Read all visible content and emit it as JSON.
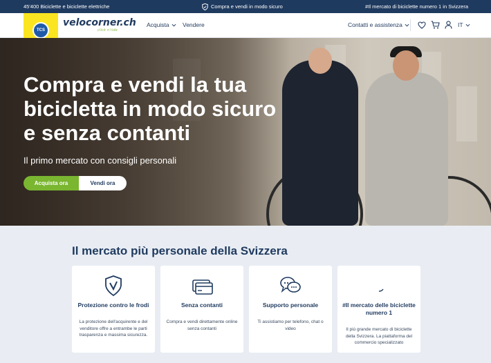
{
  "topbar": {
    "left": "45'400 Biciclette e biciclette elettriche",
    "center": "Compra e vendi in modo sicuro",
    "right": "#Il mercato di biciclette numero 1 in Svizzera"
  },
  "nav": {
    "logo_badge": "TCS",
    "brand": "velocorner.ch",
    "tagline": "click n'ride",
    "links": {
      "buy": "Acquista",
      "sell": "Vendere"
    },
    "contact": "Contatti e assistenza",
    "language": "IT",
    "icons": [
      "heart-icon",
      "cart-icon",
      "user-icon"
    ]
  },
  "hero": {
    "headline": "Compra e vendi la tua bicicletta in modo sicuro e senza contanti",
    "subline": "Il primo mercato con consigli personali",
    "buy_button": "Acquista ora",
    "sell_button": "Vendi ora"
  },
  "features": {
    "title": "Il mercato più personale della Svizzera",
    "cards": [
      {
        "icon": "shield-check-icon",
        "title": "Protezione contro le frodi",
        "text": "La protezione dell'acquirente e del venditore offre a entrambe le parti trasparenza e massima sicurezza."
      },
      {
        "icon": "card-icon",
        "title": "Senza contanti",
        "text": "Compra e vendi direttamente online senza contanti"
      },
      {
        "icon": "chat-icon",
        "title": "Supporto personale",
        "text": "Ti assistiamo per telefono, chat o video"
      },
      {
        "icon": "loading-icon",
        "title": "#Il mercato delle biciclette numero 1",
        "text": "Il più grande mercato di biciclette della Svizzera. La piattaforma del commercio specializzato"
      }
    ]
  },
  "colors": {
    "navy": "#1f3a5f",
    "green": "#7ab630",
    "yellow": "#fbe520"
  }
}
